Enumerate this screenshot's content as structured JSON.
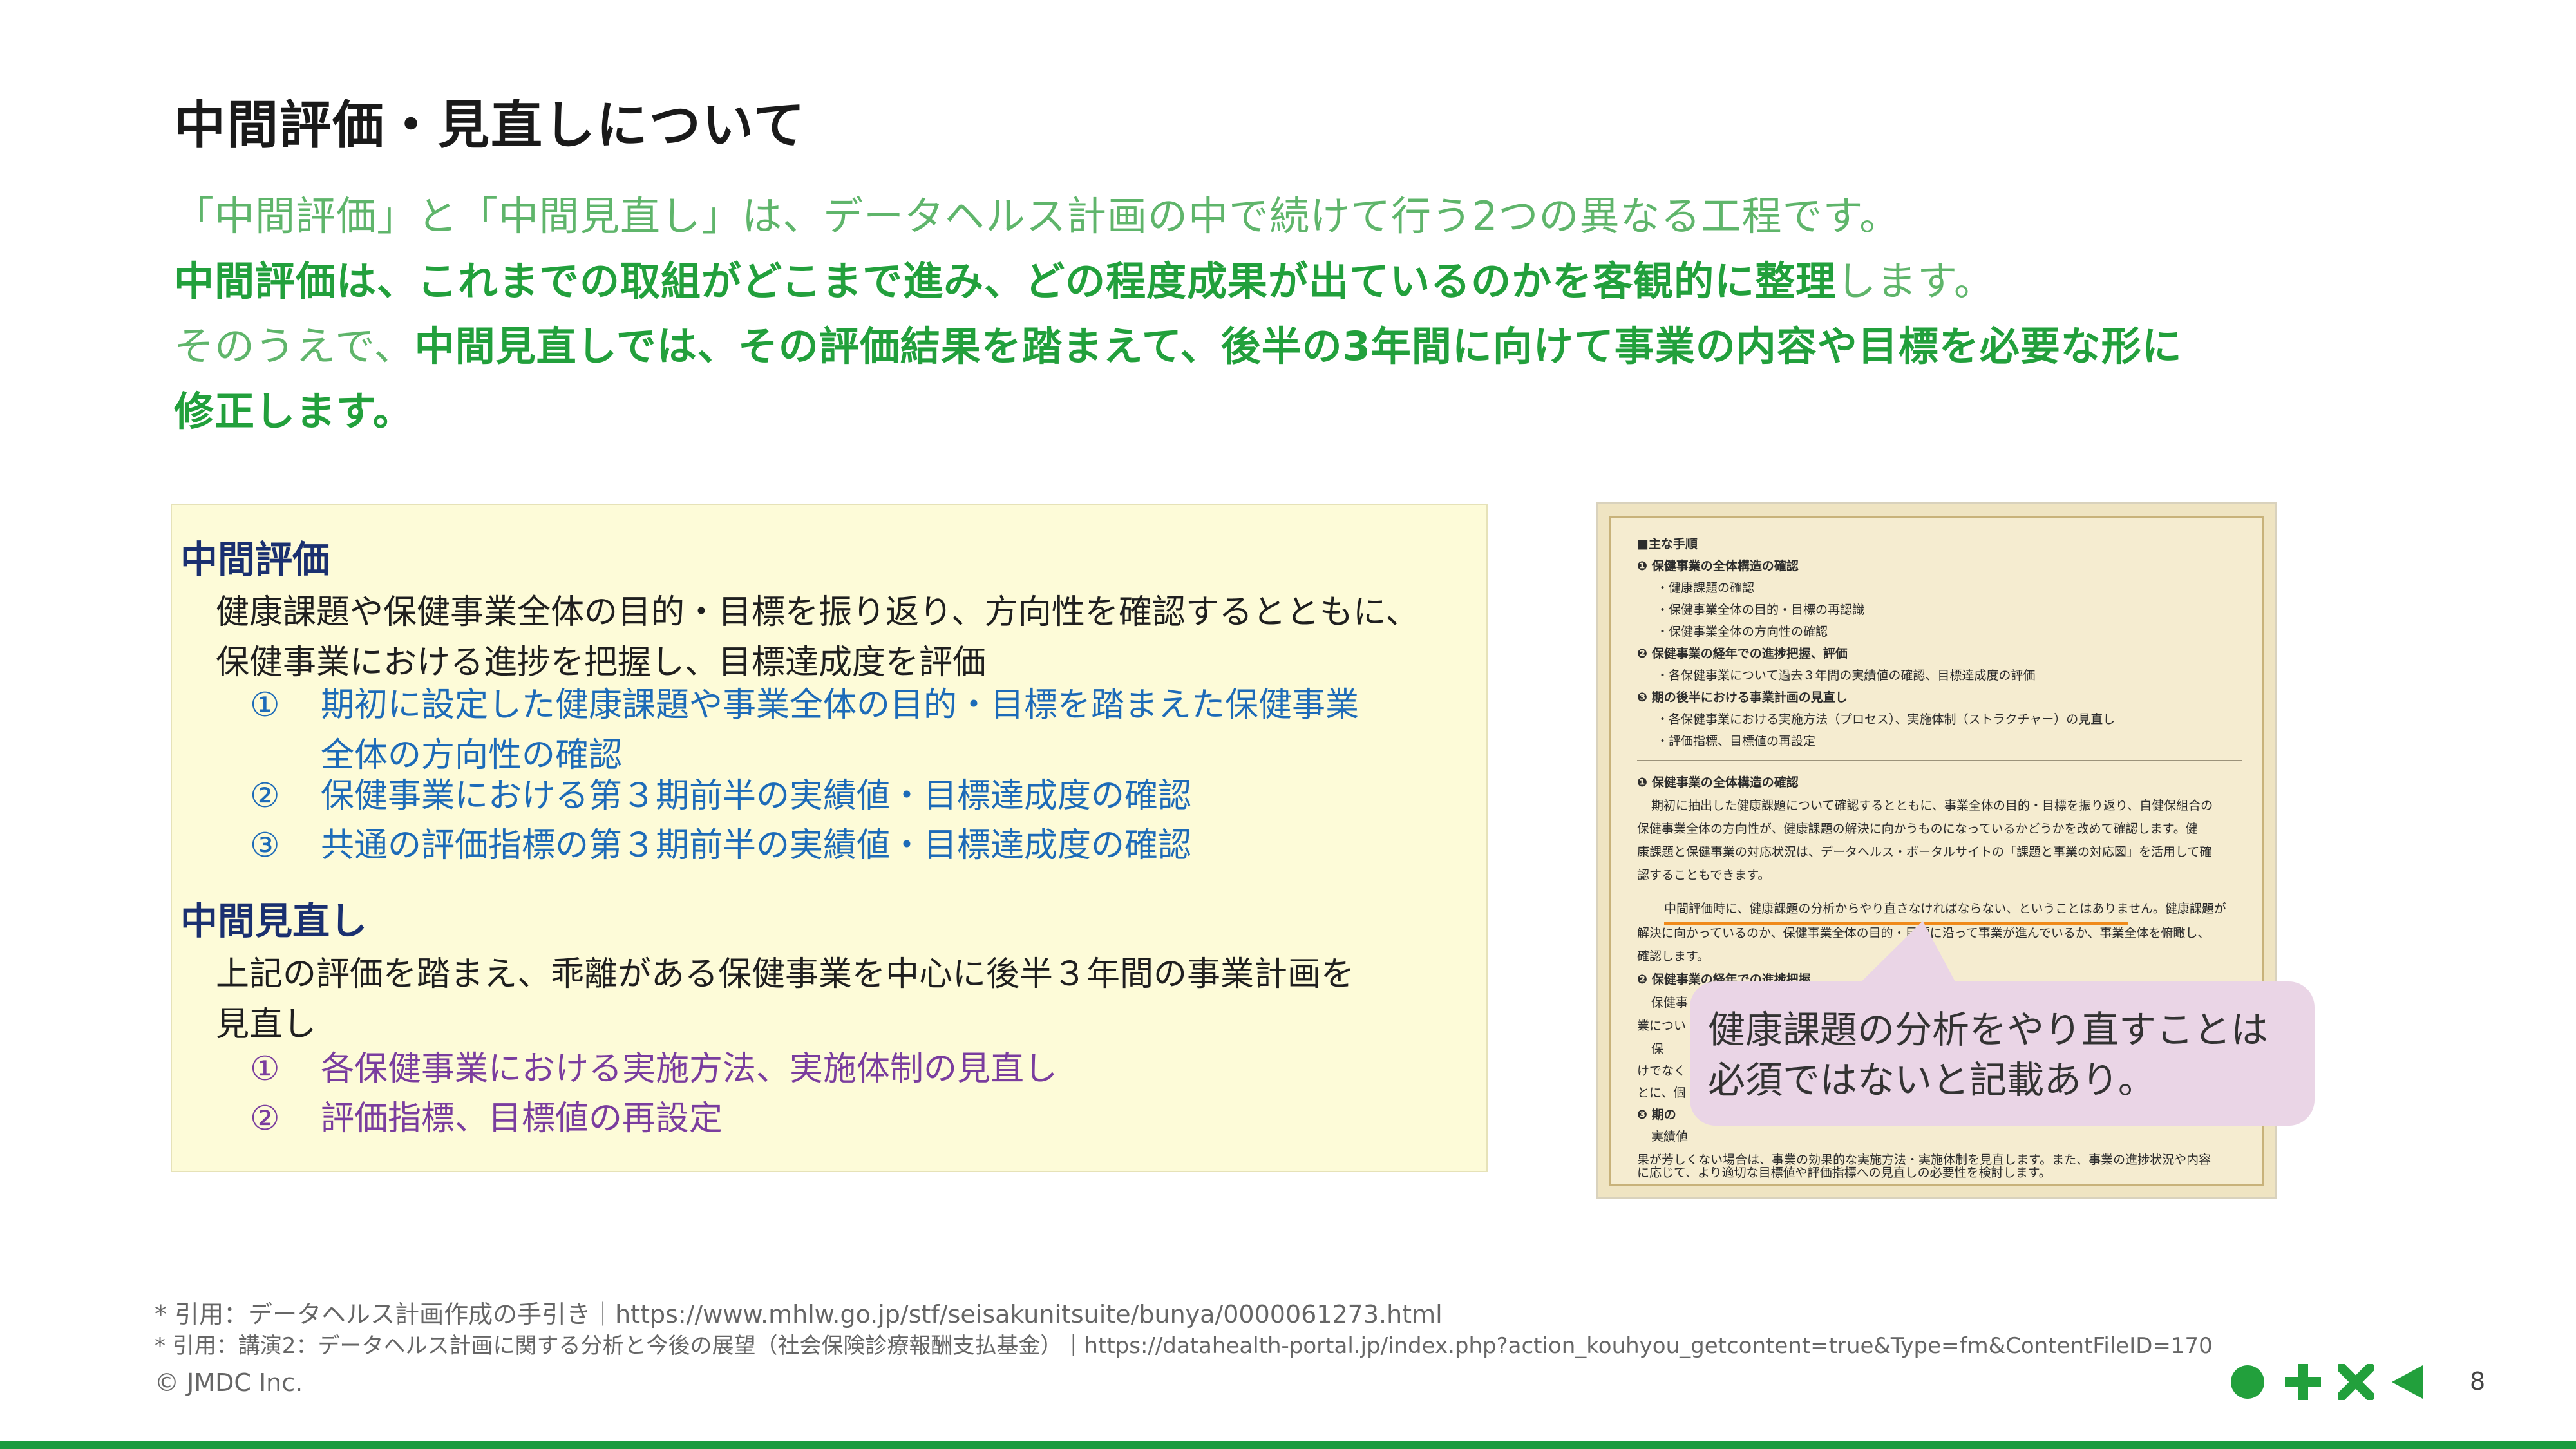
{
  "slide": {
    "title": "中間評価・見直しについて",
    "intro": {
      "line1": "「中間評価」と「中間見直し」は、データヘルス計画の中で続けて行う2つの異なる工程です。",
      "line2_bold": "中間評価は、これまでの取組がどこまで進み、どの程度成果が出ているのかを客観的に整理",
      "line2_rest": "します。",
      "line3_start": "そのうえで、",
      "line3_bold": "中間見直しでは、その評価結果を踏まえて、後半の3年間に向けて事業の内容や目標を必要な形に",
      "line4_bold": "修正します。"
    }
  },
  "evaluation": {
    "heading": "中間評価",
    "desc_line1": "健康課題や保健事業全体の目的・目標を振り返り、方向性を確認するとともに、",
    "desc_line2": "保健事業における進捗を把握し、目標達成度を評価",
    "items": [
      {
        "num": "①",
        "line1": "期初に設定した健康課題や事業全体の目的・目標を踏まえた保健事業",
        "line2": "全体の方向性の確認"
      },
      {
        "num": "②",
        "line1": "保健事業における第３期前半の実績値・目標達成度の確認"
      },
      {
        "num": "③",
        "line1": "共通の評価指標の第３期前半の実績値・目標達成度の確認"
      }
    ]
  },
  "review": {
    "heading": "中間見直し",
    "desc_line1": "上記の評価を踏まえ、乖離がある保健事業を中心に後半３年間の事業計画を",
    "desc_line2": "見直し",
    "items": [
      {
        "num": "①",
        "line1": "各保健事業における実施方法、実施体制の見直し"
      },
      {
        "num": "②",
        "line1": "評価指標、目標値の再設定"
      }
    ]
  },
  "document_image": {
    "lines": [
      "■主な手順",
      "❶ 保健事業の全体構造の確認",
      "・健康課題の確認",
      "・保健事業全体の目的・目標の再認識",
      "・保健事業全体の方向性の確認",
      "❷ 保健事業の経年での進捗把握、評価",
      "・各保健事業について過去３年間の実績値の確認、目標達成度の評価",
      "❸ 期の後半における事業計画の見直し",
      "・各保健事業における実施方法（プロセス）、実施体制（ストラクチャー）の見直し",
      "・評価指標、目標値の再設定",
      "❶ 保健事業の全体構造の確認",
      "期初に抽出した健康課題について確認するとともに、事業全体の目的・目標を振り返り、自健保組合の",
      "保健事業全体の方向性が、健康課題の解決に向かうものになっているかどうかを改めて確認します。健",
      "康課題と保健事業の対応状況は、データヘルス・ポータルサイトの「課題と事業の対応図」を活用して確",
      "認することもできます。",
      "中間評価時に、健康課題の分析からやり直さなければならない、ということはありません。健康課題が",
      "解決に向かっているのか、保健事業全体の目的・目標に沿って事業が進んでいるか、事業全体を俯瞰し、",
      "確認します。",
      "❷ 保健事業の経年での進捗把握",
      "保健事",
      "業につい",
      "保",
      "けでなく",
      "とに、個",
      "❸ 期の",
      "実績値",
      "果が芳しくない場合は、事業の効果的な実施方法・実施体制を見直します。また、事業の進捗状況や内容",
      "に応じて、より適切な目標値や評価指標への見直しの必要性を検討します。"
    ]
  },
  "callout": {
    "line1": "健康課題の分析をやり直すことは",
    "line2": "必須ではないと記載あり。"
  },
  "footer": {
    "ref1": "* 引用：データヘルス計画作成の手引き｜https://www.mhlw.go.jp/stf/seisakunitsuite/bunya/0000061273.html",
    "ref2": "* 引用：講演2：データヘルス計画に関する分析と今後の展望（社会保険診療報酬支払基金）｜https://datahealth-portal.jp/index.php?action_kouhyou_getcontent=true&Type=fm&ContentFileID=170",
    "copyright": "© JMDC Inc.",
    "page": "8"
  },
  "colors": {
    "accent_green": "#22a03c",
    "heading_navy": "#1a3070",
    "item_blue": "#1d6bb8",
    "item_purple": "#7a3d9e",
    "box_yellow": "#fdfbd8",
    "callout_pink": "#ead5e6"
  },
  "logo_icons": [
    "circle-icon",
    "plus-icon",
    "cross-icon",
    "triangle-icon"
  ]
}
